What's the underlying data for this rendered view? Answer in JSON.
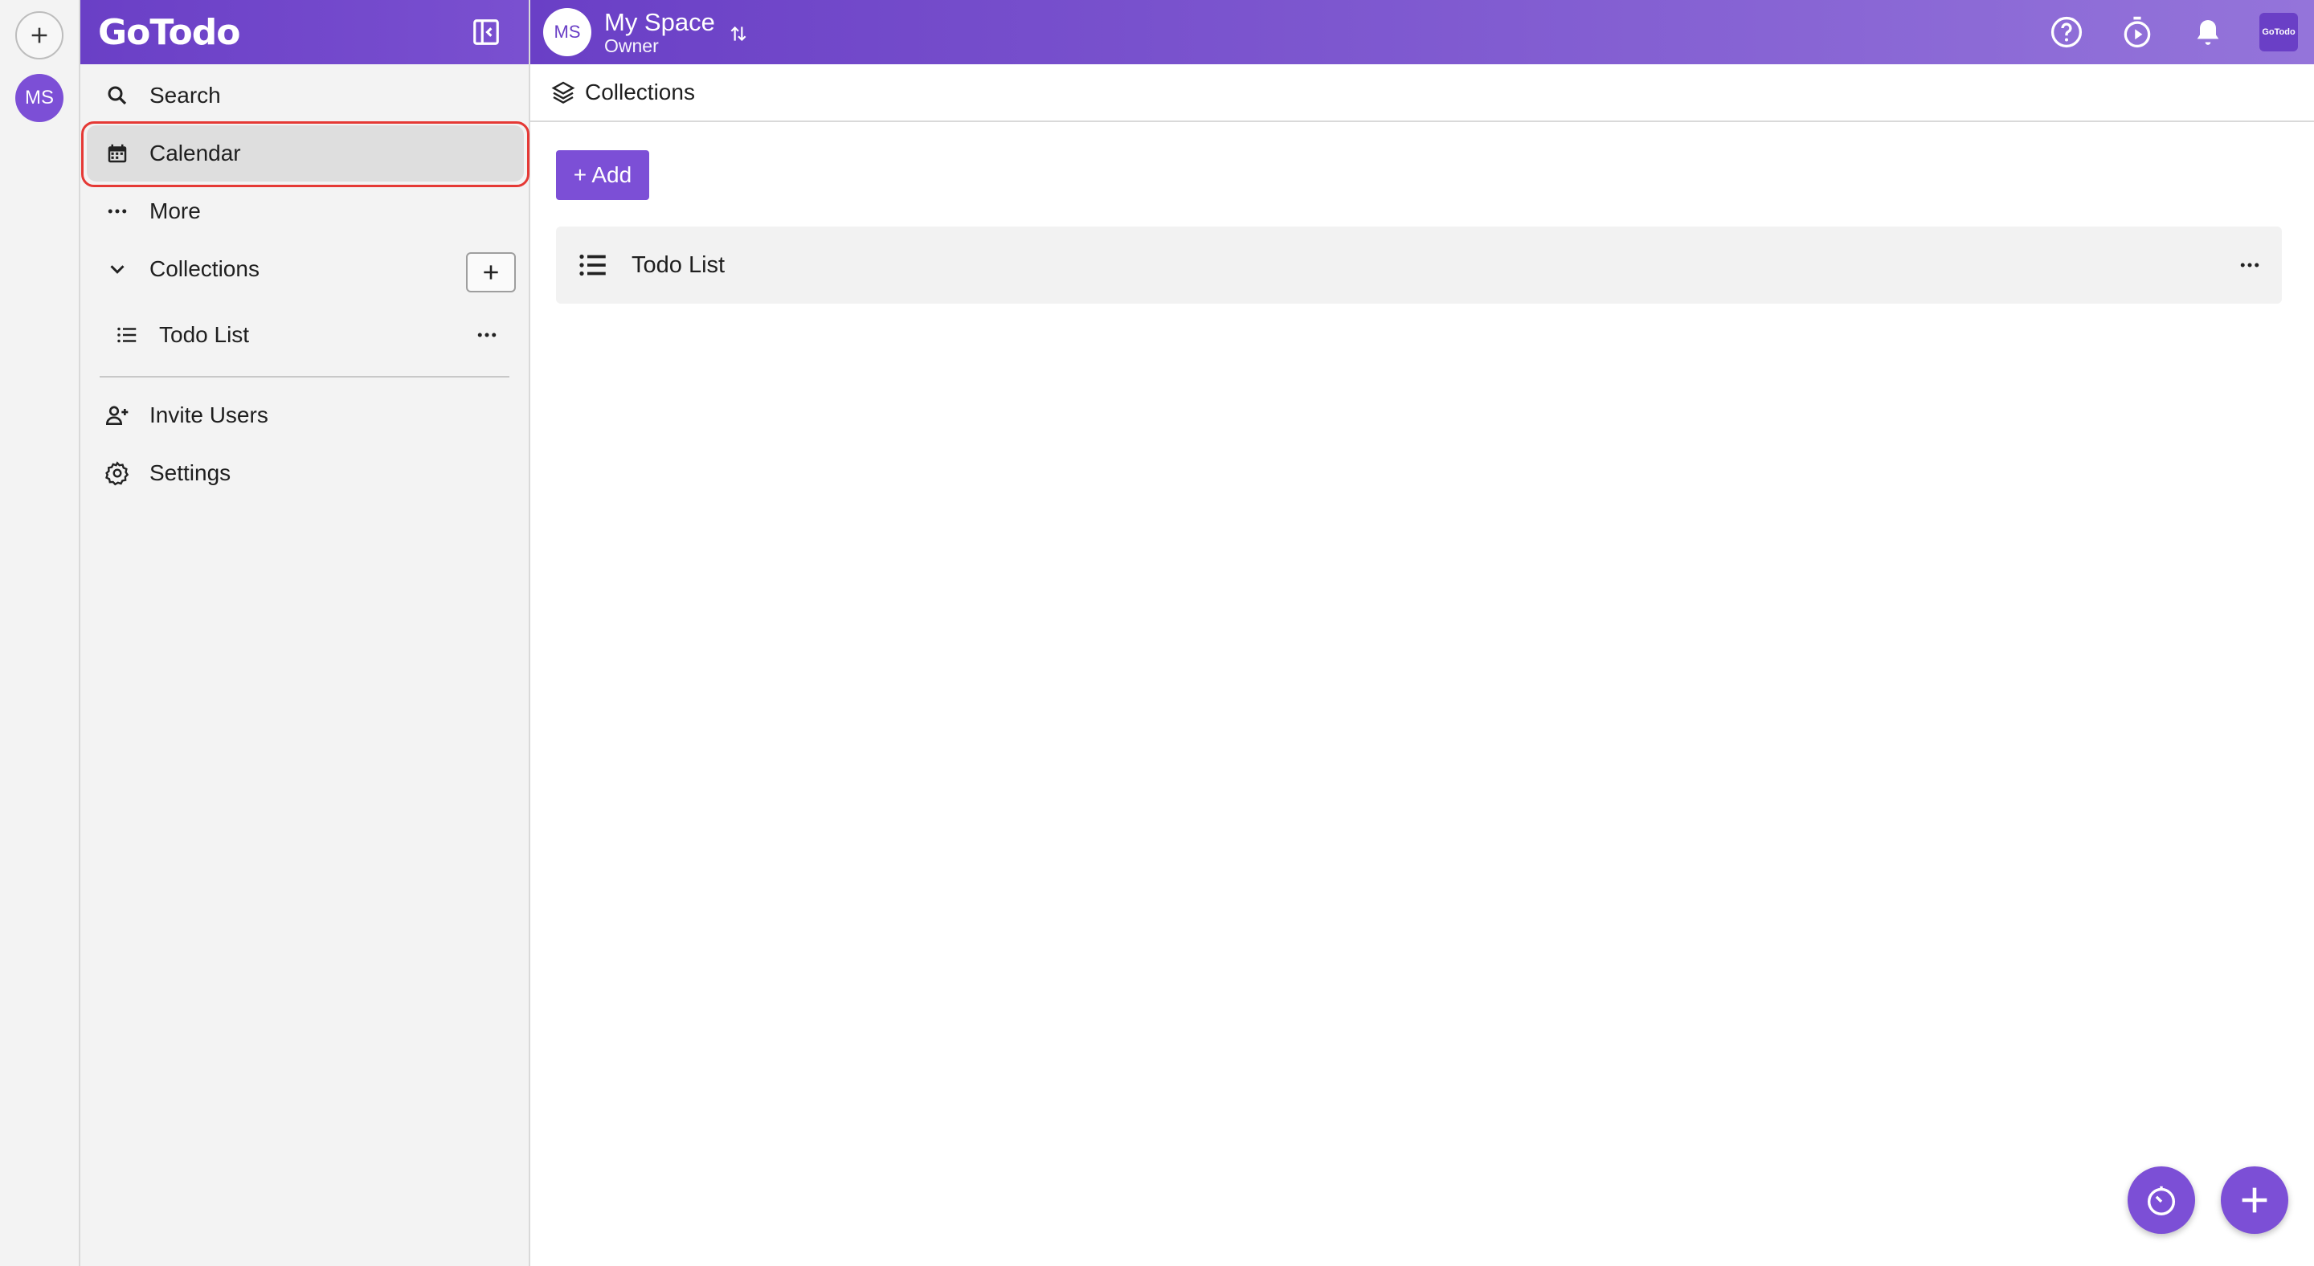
{
  "app": {
    "logo": "GoTodo",
    "brand_tile": "GoTodo"
  },
  "rail": {
    "avatar_initials": "MS"
  },
  "sidebar": {
    "items": [
      {
        "label": "Search",
        "icon": "search-icon"
      },
      {
        "label": "Calendar",
        "icon": "calendar-icon",
        "active": true
      },
      {
        "label": "More",
        "icon": "more-horizontal-icon"
      }
    ],
    "collections_label": "Collections",
    "collections": [
      {
        "label": "Todo List",
        "icon": "list-icon"
      }
    ],
    "invite_label": "Invite Users",
    "settings_label": "Settings"
  },
  "space": {
    "initials": "MS",
    "name": "My Space",
    "role": "Owner"
  },
  "main": {
    "breadcrumb": "Collections",
    "add_label": "+ Add",
    "collections": [
      {
        "label": "Todo List"
      }
    ]
  },
  "colors": {
    "accent": "#7c4fd6",
    "header_start": "#6a3fc6",
    "header_end": "#9474da",
    "highlight": "#e53935"
  }
}
